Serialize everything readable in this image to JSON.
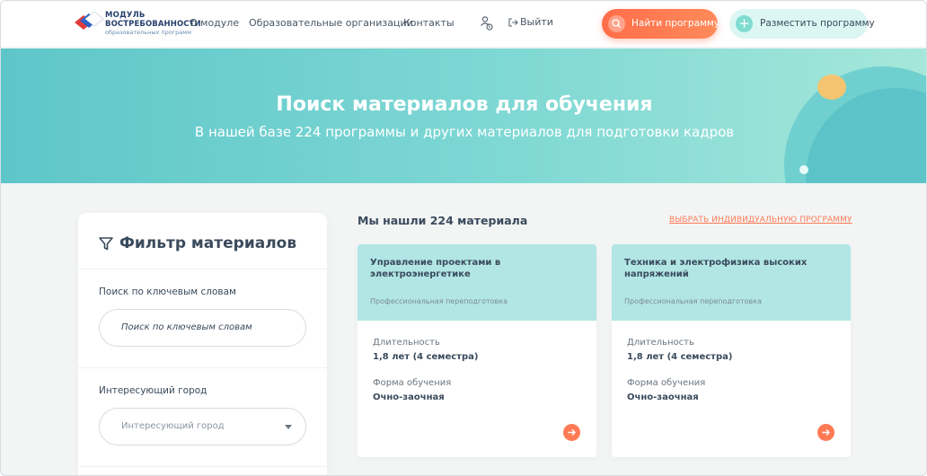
{
  "header": {
    "logo": {
      "line1": "МОДУЛЬ",
      "line2": "ВОСТРЕБОВАННОСТИ",
      "line3": "образовательных программ"
    },
    "nav": {
      "about": "О модуле",
      "orgs": "Образовательные организации",
      "contacts": "Контакты"
    },
    "logout": "Выйти",
    "find_button": "Найти программу",
    "post_button": "Разместить программу",
    "post_icon": "+"
  },
  "hero": {
    "title": "Поиск материалов для обучения",
    "subtitle": "В нашей базе 224 программы и других материалов для подготовки кадров"
  },
  "filter": {
    "title": "Фильтр материалов",
    "keywords_label": "Поиск по ключевым словам",
    "keywords_placeholder": "Поиск по ключевым словам",
    "city_label": "Интересующий город",
    "city_placeholder": "Интересующий город"
  },
  "results": {
    "found_text": "Мы нашли 224 материала",
    "choose_link": "ВЫБРАТЬ ИНДИВИДУАЛЬНУЮ ПРОГРАММУ",
    "cards": [
      {
        "title": "Управление проектами в электроэнергетике",
        "type": "Профессиональная переподготовка",
        "duration_label": "Длительность",
        "duration_value": "1,8 лет (4 семестра)",
        "form_label": "Форма обучения",
        "form_value": "Очно-заочная"
      },
      {
        "title": "Техника и электрофизика высоких напряжений",
        "type": "Профессиональная переподготовка",
        "duration_label": "Длительность",
        "duration_value": "1,8 лет (4 семестра)",
        "form_label": "Форма обучения",
        "form_value": "Очно-заочная"
      }
    ]
  },
  "colors": {
    "accent": "#ff7a55",
    "teal": "#5ec6c9",
    "card_header": "#b1e6e4",
    "text": "#3a4a5c"
  },
  "icons": [
    "logo-mark",
    "settings-people-icon",
    "logout-icon",
    "search-icon",
    "plus-icon",
    "filter-icon",
    "chevron-down-icon",
    "arrow-right-icon"
  ]
}
